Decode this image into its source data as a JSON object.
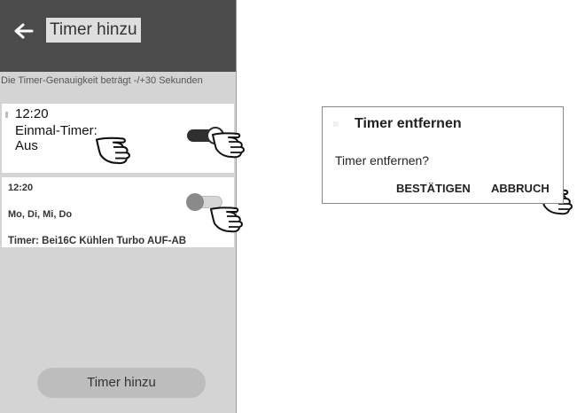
{
  "header": {
    "title": "Timer hinzu",
    "back_icon": "back-arrow-icon"
  },
  "hint": "Die Timer-Genauigkeit beträgt -/+30 Sekunden",
  "timers": [
    {
      "time": "12:20",
      "description": "Einmal-Timer: Aus",
      "enabled": true
    },
    {
      "time": "12:20",
      "days": "Mo, Di, Mi, Do",
      "detail": "Timer: Bei16C Kühlen Turbo AUF-AB",
      "enabled": false
    }
  ],
  "add_button": "Timer hinzu",
  "dialog": {
    "title": "Timer entfernen",
    "message": "Timer entfernen?",
    "confirm": "BESTÄTIGEN",
    "cancel": "ABBRUCH"
  },
  "colors": {
    "appbar": "#4b4b4b",
    "screen_bg": "#d4d4d4",
    "toggle_on": "#2f2f2f",
    "button": "#bdbdbd"
  }
}
